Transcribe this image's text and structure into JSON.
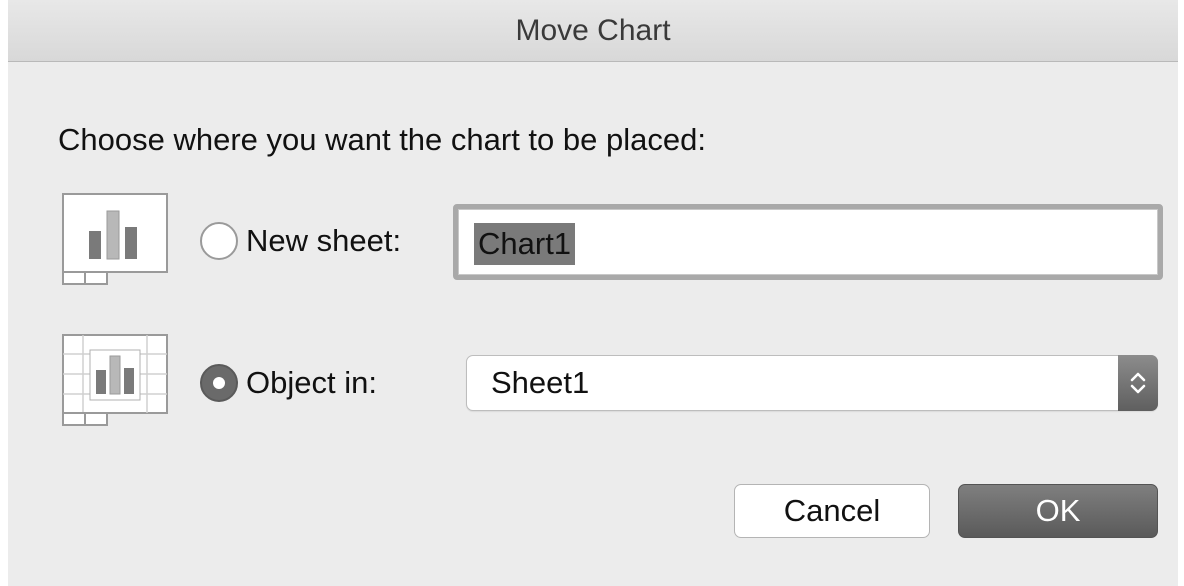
{
  "window": {
    "title": "Move Chart"
  },
  "prompt": "Choose where you want the chart to be placed:",
  "options": {
    "new_sheet": {
      "label": "New sheet:",
      "selected": false,
      "value": "Chart1",
      "icon": "chart-sheet-icon"
    },
    "object_in": {
      "label": "Object in:",
      "selected": true,
      "value": "Sheet1",
      "icon": "embedded-chart-icon"
    }
  },
  "buttons": {
    "cancel": "Cancel",
    "ok": "OK"
  },
  "colors": {
    "dialog_background": "#ececec",
    "selection_highlight": "#7a7a7a",
    "default_button": "#6a6a6a"
  }
}
